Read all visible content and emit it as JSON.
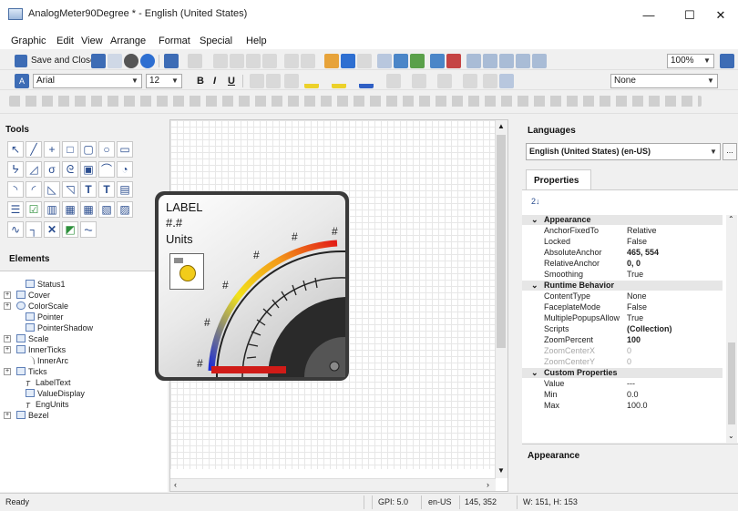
{
  "window": {
    "title": "AnalogMeter90Degree * - English (United States)",
    "minimize_glyph": "—",
    "maximize_glyph": "☐",
    "close_glyph": "✕"
  },
  "menu": [
    "Graphic",
    "Edit",
    "View",
    "Arrange",
    "Format",
    "Special",
    "Help"
  ],
  "toolbar1": {
    "save_close_label": "Save and Close",
    "zoom_value": "100%"
  },
  "toolbar2": {
    "font_name": "Arial",
    "font_size": "12",
    "bold": "B",
    "italic": "I",
    "underline": "U",
    "line_style_value": "None"
  },
  "tools_panel": {
    "title": "Tools"
  },
  "elements_panel": {
    "title": "Elements",
    "items": [
      {
        "label": "Status1",
        "expander": ""
      },
      {
        "label": "Cover",
        "expander": "+"
      },
      {
        "label": "ColorScale",
        "expander": "+"
      },
      {
        "label": "Pointer",
        "expander": ""
      },
      {
        "label": "PointerShadow",
        "expander": ""
      },
      {
        "label": "Scale",
        "expander": "+"
      },
      {
        "label": "InnerTicks",
        "expander": "+"
      },
      {
        "label": "InnerArc",
        "expander": ""
      },
      {
        "label": "Ticks",
        "expander": "+"
      },
      {
        "label": "LabelText",
        "expander": ""
      },
      {
        "label": "ValueDisplay",
        "expander": ""
      },
      {
        "label": "EngUnits",
        "expander": ""
      },
      {
        "label": "Bezel",
        "expander": "+"
      }
    ]
  },
  "gauge": {
    "label": "LABEL",
    "value": "#.#",
    "units": "Units",
    "tick_label": "#",
    "colors": {
      "blue": "#1a2ad8",
      "yellow": "#f2e21a",
      "orange": "#f39a1a",
      "red": "#e21c16"
    }
  },
  "languages_panel": {
    "title": "Languages",
    "selected_language": "English (United States) (en-US)",
    "ellipsis": "..."
  },
  "properties_panel": {
    "tab": "Properties",
    "sort_icon_text": "2↓",
    "categories": [
      {
        "name": "Appearance",
        "rows": [
          {
            "key": "AnchorFixedTo",
            "value": "Relative",
            "bold": false,
            "disabled": false
          },
          {
            "key": "Locked",
            "value": "False",
            "bold": false,
            "disabled": false
          },
          {
            "key": "AbsoluteAnchor",
            "value": "465, 554",
            "bold": true,
            "disabled": false
          },
          {
            "key": "RelativeAnchor",
            "value": "0, 0",
            "bold": true,
            "disabled": false
          },
          {
            "key": "Smoothing",
            "value": "True",
            "bold": false,
            "disabled": false
          }
        ]
      },
      {
        "name": "Runtime Behavior",
        "rows": [
          {
            "key": "ContentType",
            "value": "None",
            "bold": false,
            "disabled": false
          },
          {
            "key": "FaceplateMode",
            "value": "False",
            "bold": false,
            "disabled": false
          },
          {
            "key": "MultiplePopupsAllow",
            "value": "True",
            "bold": false,
            "disabled": false
          },
          {
            "key": "Scripts",
            "value": "(Collection)",
            "bold": true,
            "disabled": false
          },
          {
            "key": "ZoomPercent",
            "value": "100",
            "bold": true,
            "disabled": false
          },
          {
            "key": "ZoomCenterX",
            "value": "0",
            "bold": false,
            "disabled": true
          },
          {
            "key": "ZoomCenterY",
            "value": "0",
            "bold": false,
            "disabled": true
          }
        ]
      },
      {
        "name": "Custom Properties",
        "rows": [
          {
            "key": "Value",
            "value": "---",
            "bold": false,
            "disabled": false
          },
          {
            "key": "Min",
            "value": "0.0",
            "bold": false,
            "disabled": false
          },
          {
            "key": "Max",
            "value": "100.0",
            "bold": false,
            "disabled": false
          }
        ]
      }
    ],
    "description_title": "Appearance"
  },
  "status_bar": {
    "status": "Ready",
    "gpi": "GPI: 5.0",
    "culture": "en-US",
    "position": "145, 352",
    "size": "W: 151, H: 153"
  }
}
